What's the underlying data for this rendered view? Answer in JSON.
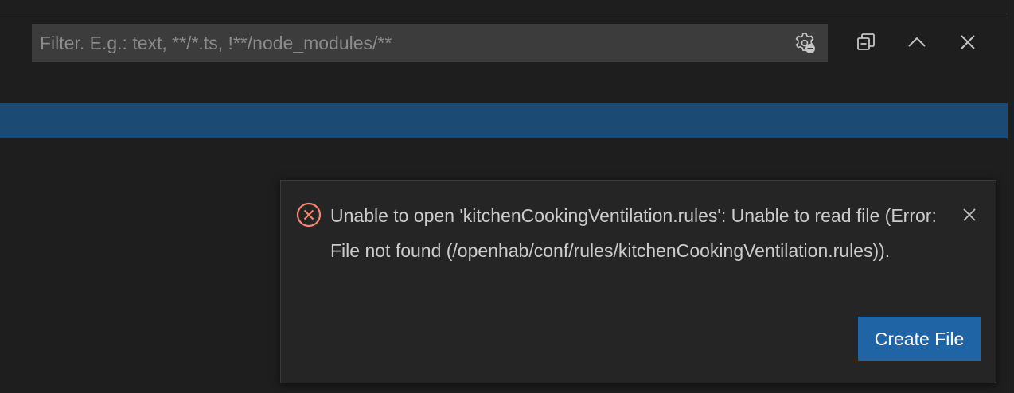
{
  "filter": {
    "placeholder": "Filter. E.g.: text, **/*.ts, !**/node_modules/**",
    "value": "",
    "settings_icon": "gear-filter-icon"
  },
  "toolbar": {
    "collapse_all_icon": "collapse-all-icon",
    "maximize_icon": "chevron-up-icon",
    "close_icon": "close-icon"
  },
  "notification": {
    "severity": "error",
    "icon": "error-circle-icon",
    "message": "Unable to open 'kitchenCookingVentilation.rules': Unable to read file (Error: File not found (/openhab/conf/rules/kitchenCookingVentilation.rules)).",
    "close_icon": "close-icon",
    "action_label": "Create File"
  },
  "colors": {
    "background": "#1e1e1e",
    "input_background": "#3c3c3c",
    "selection_band": "#1b4a74",
    "notification_background": "#252526",
    "error": "#f48771",
    "button": "#1f65a5",
    "text": "#cccccc"
  }
}
